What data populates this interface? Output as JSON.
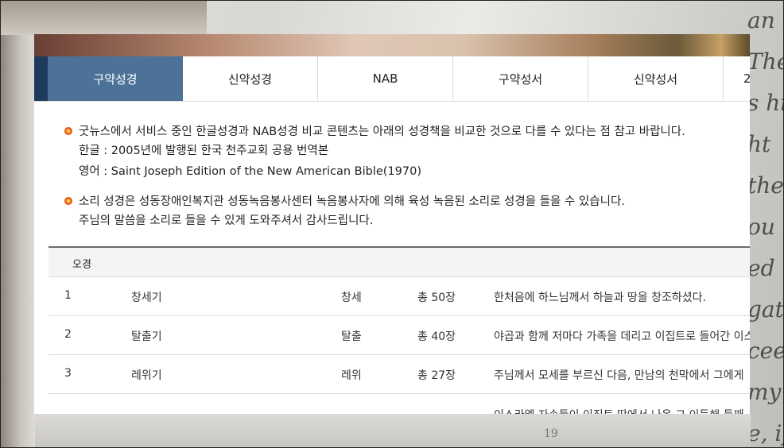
{
  "background": {
    "text_lines": [
      "an",
      "The",
      "s hi",
      "ht",
      "the",
      "ou",
      "ed",
      "gat",
      "ceer",
      "my",
      "e, if you"
    ],
    "page_number": "19"
  },
  "tabs": [
    {
      "label": "구약성경",
      "active": true
    },
    {
      "label": "신약성경",
      "active": false
    },
    {
      "label": "NAB",
      "active": false
    },
    {
      "label": "구약성서",
      "active": false
    },
    {
      "label": "신약성서",
      "active": false
    },
    {
      "label": "2",
      "active": false
    }
  ],
  "notes": [
    {
      "lines": [
        "굿뉴스에서 서비스 중인 한글성경과 NAB성경 비교 콘텐츠는 아래의 성경책을 비교한 것으로 다를 수 있다는 점 참고 바랍니다.",
        "한글 : 2005년에 발행된 한국 천주교회 공용 번역본",
        "영어 : Saint Joseph Edition of the New American Bible(1970)"
      ]
    },
    {
      "lines": [
        "소리 성경은 성동장애인복지관 성동녹음봉사센터 녹음봉사자에 의해 육성 녹음된 소리로 성경을 들을 수 있습니다.",
        "주님의 말씀을 소리로 들을 수 있게 도와주셔서 감사드립니다."
      ]
    }
  ],
  "table": {
    "header": "오경",
    "rows": [
      {
        "no": "1",
        "name": "창세기",
        "abbr": "창세",
        "chapters": "총 50장",
        "desc": "한처음에 하느님께서 하늘과 땅을 창조하셨다."
      },
      {
        "no": "2",
        "name": "탈출기",
        "abbr": "탈출",
        "chapters": "총 40장",
        "desc": "야곱과 함께 저마다 가족을 데리고 이집트로 들어간 이스"
      },
      {
        "no": "3",
        "name": "레위기",
        "abbr": "레위",
        "chapters": "총 27장",
        "desc": "주님께서 모세를 부르신 다음, 만남의 천막에서 그에게"
      },
      {
        "no": "",
        "name": "",
        "abbr": "",
        "chapters": "",
        "desc": "이스라엘 자손들이 이집트 땅에서 나온 그 이듬해 둘째"
      }
    ]
  }
}
